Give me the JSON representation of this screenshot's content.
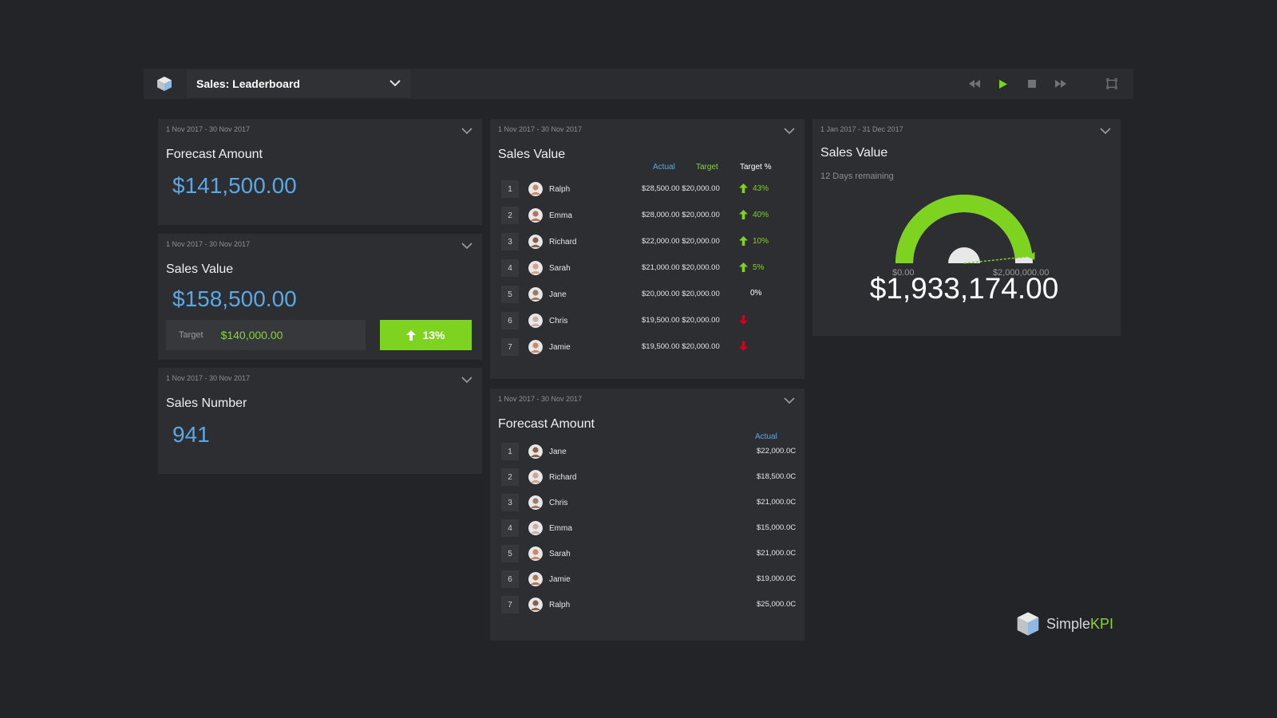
{
  "header": {
    "dashboard_title": "Sales: Leaderboard"
  },
  "icons": {
    "logo": "cube-logo-icon",
    "dropdown": "chevron-down-icon",
    "rewind": "rewind-icon",
    "play": "play-icon",
    "stop": "stop-icon",
    "fast_forward": "fast-forward-icon",
    "fullscreen": "fullscreen-icon"
  },
  "colors": {
    "background": "#222427",
    "card": "#2c2e31",
    "blue_value": "#5aa9e6",
    "green": "#7ed321",
    "red": "#d0021b"
  },
  "card_forecast_amount": {
    "date_range": "1 Nov 2017 - 30 Nov 2017",
    "title": "Forecast Amount",
    "value": "$141,500.00"
  },
  "card_sales_value_small": {
    "date_range": "1 Nov 2017 - 30 Nov 2017",
    "title": "Sales Value",
    "value": "$158,500.00",
    "target_label": "Target",
    "target_value": "$140,000.00",
    "percent": "13%"
  },
  "card_sales_number": {
    "date_range": "1 Nov 2017 - 30 Nov 2017",
    "title": "Sales Number",
    "value": "941"
  },
  "card_sales_leaderboard": {
    "date_range": "1 Nov 2017 - 30 Nov 2017",
    "title": "Sales Value",
    "col_actual": "Actual",
    "col_target": "Target",
    "col_target_pct": "Target %",
    "rows": [
      {
        "rank": "1",
        "name": "Ralph",
        "actual": "$28,500.00",
        "target": "$20,000.00",
        "pct": "43%",
        "trend": "up"
      },
      {
        "rank": "2",
        "name": "Emma",
        "actual": "$28,000.00",
        "target": "$20,000.00",
        "pct": "40%",
        "trend": "up"
      },
      {
        "rank": "3",
        "name": "Richard",
        "actual": "$22,000.00",
        "target": "$20,000.00",
        "pct": "10%",
        "trend": "up"
      },
      {
        "rank": "4",
        "name": "Sarah",
        "actual": "$21,000.00",
        "target": "$20,000.00",
        "pct": "5%",
        "trend": "up"
      },
      {
        "rank": "5",
        "name": "Jane",
        "actual": "$20,000.00",
        "target": "$20,000.00",
        "pct": "0%",
        "trend": "none"
      },
      {
        "rank": "6",
        "name": "Chris",
        "actual": "$19,500.00",
        "target": "$20,000.00",
        "pct": "",
        "trend": "down"
      },
      {
        "rank": "7",
        "name": "Jamie",
        "actual": "$19,500.00",
        "target": "$20,000.00",
        "pct": "",
        "trend": "down"
      }
    ]
  },
  "card_forecast_leaderboard": {
    "date_range": "1 Nov 2017 - 30 Nov 2017",
    "title": "Forecast Amount",
    "col_actual": "Actual",
    "rows": [
      {
        "rank": "1",
        "name": "Jane",
        "actual": "$22,000.0C"
      },
      {
        "rank": "2",
        "name": "Richard",
        "actual": "$18,500.0C"
      },
      {
        "rank": "3",
        "name": "Chris",
        "actual": "$21,000.0C"
      },
      {
        "rank": "4",
        "name": "Emma",
        "actual": "$15,000.0C"
      },
      {
        "rank": "5",
        "name": "Sarah",
        "actual": "$21,000.0C"
      },
      {
        "rank": "6",
        "name": "Jamie",
        "actual": "$19,000.0C"
      },
      {
        "rank": "7",
        "name": "Ralph",
        "actual": "$25,000.0C"
      }
    ]
  },
  "card_sales_gauge": {
    "date_range": "1 Jan 2017 - 31 Dec 2017",
    "title": "Sales Value",
    "subtitle": "12 Days remaining",
    "min_label": "$0.00",
    "max_label": "$2,000,000.00",
    "total": "$1,933,174.00",
    "fill_fraction": 0.967
  },
  "brand": {
    "name_part1": "Simple",
    "name_part2": "KPI"
  }
}
